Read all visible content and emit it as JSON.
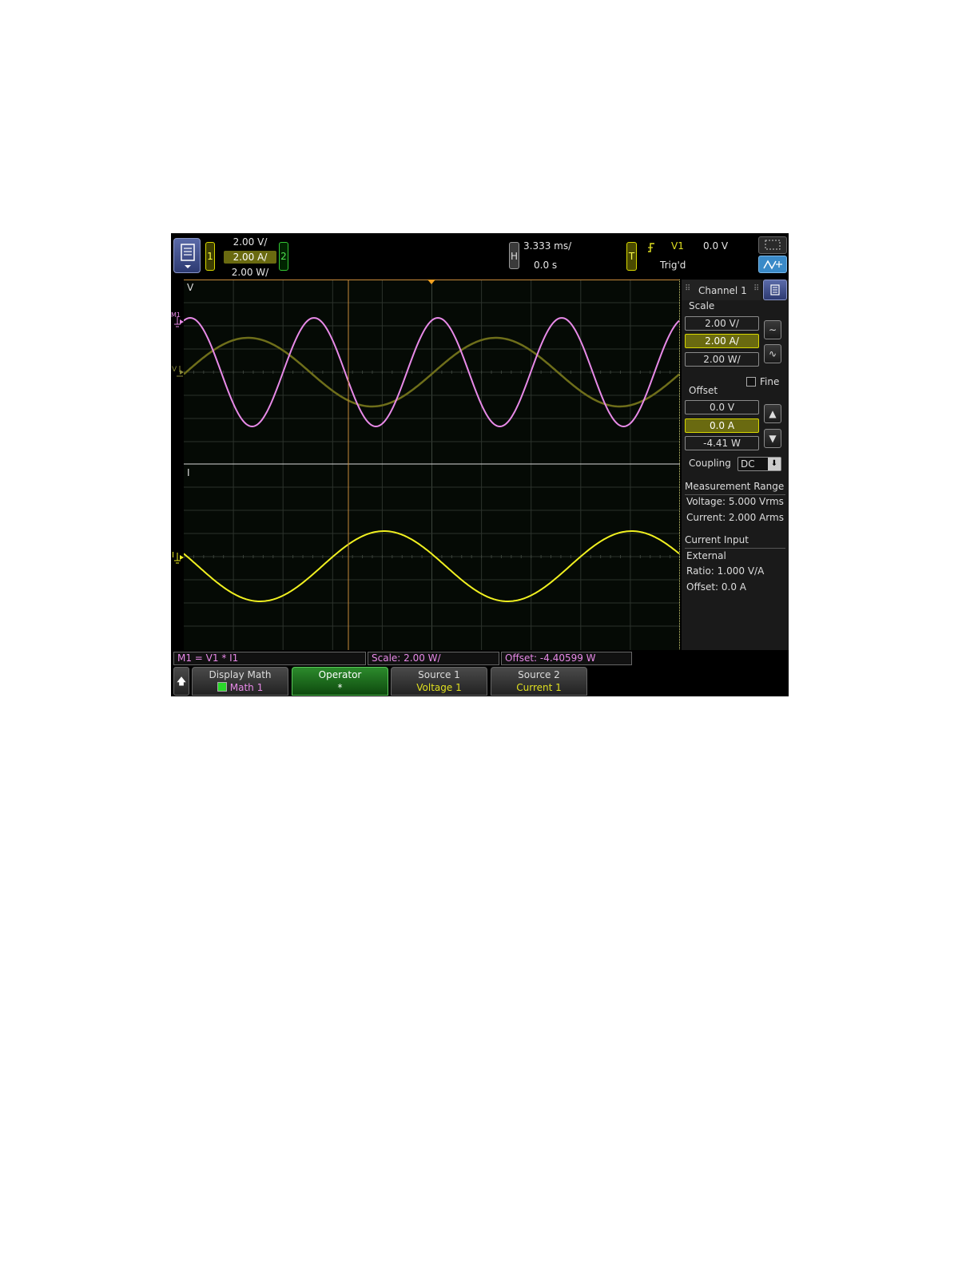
{
  "top_bar": {
    "channel1_label": "1",
    "channel2_label": "2",
    "scales": [
      "2.00 V/",
      "2.00 A/",
      "2.00 W/"
    ],
    "horizontal_label": "H",
    "timebase": "3.333 ms/",
    "delay": "0.0 s",
    "trigger_label": "T",
    "trigger_source": "V1",
    "trigger_level": "0.0 V",
    "trigger_status": "Trig'd"
  },
  "waveform": {
    "upper_pane_label": "V",
    "lower_pane_label": "I",
    "m1_marker": "M1",
    "v_marker": "V",
    "i_marker": "I"
  },
  "right_panel": {
    "title": "Channel 1",
    "scale_heading": "Scale",
    "scale_values": [
      "2.00 V/",
      "2.00 A/",
      "2.00 W/"
    ],
    "fine_label": "Fine",
    "offset_heading": "Offset",
    "offset_values": [
      "0.0 V",
      "0.0 A",
      "-4.41 W"
    ],
    "coupling_label": "Coupling",
    "coupling_value": "DC",
    "measurement_range_heading": "Measurement Range",
    "voltage_range": "Voltage: 5.000 Vrms",
    "current_range": "Current: 2.000 Arms",
    "current_input_heading": "Current Input",
    "current_input_type": "External",
    "ratio": "Ratio:  1.000 V/A",
    "offset_info": "Offset: 0.0 A"
  },
  "status_bar": {
    "formula": "M1 = V1 * I1",
    "scale": "Scale: 2.00 W/",
    "offset": "Offset: -4.40599 W"
  },
  "softkeys": [
    {
      "title": "Display Math",
      "value": "Math 1"
    },
    {
      "title": "Operator",
      "value": "*"
    },
    {
      "title": "Source 1",
      "value": "Voltage 1"
    },
    {
      "title": "Source 2",
      "value": "Current 1"
    }
  ],
  "colors": {
    "voltage_trace": "#6e6e1a",
    "current_trace": "#f0f020",
    "math_trace": "#e88ae8",
    "cursor": "#c88a3a",
    "channel1": "#d8d800",
    "channel2": "#34c834"
  }
}
